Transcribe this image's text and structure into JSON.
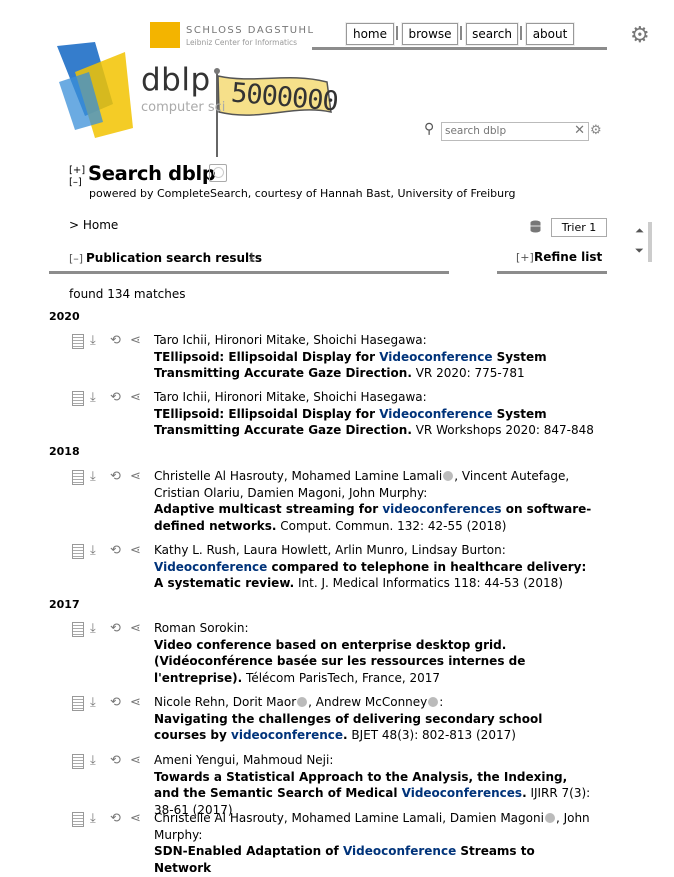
{
  "header": {
    "dagstuhl_title": "SCHLOSS DAGSTUHL",
    "dagstuhl_subtitle": "Leibniz Center for Informatics",
    "nav": [
      "home",
      "browse",
      "search",
      "about"
    ],
    "settings_icon": "gear-icon"
  },
  "logo": {
    "word": "dblp",
    "subtitle": "computer sci",
    "flag_text": "5000000"
  },
  "search": {
    "placeholder": "search dblp",
    "value": ""
  },
  "page": {
    "expand": "[+]",
    "collapse": "[–]",
    "title": "Search dblp",
    "powered_by": "powered by CompleteSearch, courtesy of Hannah Bast, University of Freiburg",
    "breadcrumb": "> Home",
    "mirror": "Trier 1"
  },
  "results": {
    "toggle": "[–]",
    "label": "Publication search results",
    "refine_toggle": "[+]",
    "refine_label": "Refine list",
    "found": "found 134 matches"
  },
  "years": [
    "2020",
    "2018",
    "2017"
  ],
  "entries": [
    {
      "authors": "Taro Ichii, Hironori Mitake, Shoichi Hasegawa:",
      "title_a": "TEllipsoid: Ellipsoidal Display for ",
      "title_hl": "Videoconference",
      "title_b": " System Transmitting Accurate Gaze Direction.",
      "venue": " VR 2020: 775-781"
    },
    {
      "authors": "Taro Ichii, Hironori Mitake, Shoichi Hasegawa:",
      "title_a": "TEllipsoid: Ellipsoidal Display for ",
      "title_hl": "Videoconference",
      "title_b": " System Transmitting Accurate Gaze Direction.",
      "venue": " VR Workshops 2020: 847-848"
    },
    {
      "authors_a": "Christelle Al Hasrouty, Mohamed Lamine Lamali",
      "authors_b": ", Vincent Autefage, Cristian Olariu, Damien Magoni, John Murphy:",
      "title_a": "Adaptive multicast streaming for ",
      "title_hl": "videoconferences",
      "title_b": " on software-defined networks.",
      "venue": " Comput. Commun. 132: 42-55 (2018)"
    },
    {
      "authors": "Kathy L. Rush, Laura Howlett, Arlin Munro, Lindsay Burton:",
      "title_a": "",
      "title_hl": "Videoconference",
      "title_b": " compared to telephone in healthcare delivery: A systematic review.",
      "venue": " Int. J. Medical Informatics 118: 44-53 (2018)"
    },
    {
      "authors": "Roman Sorokin:",
      "title_a": "Video conference based on enterprise desktop grid. (Vidéoconférence basée sur les ressources internes de l'entreprise).",
      "title_hl": "",
      "title_b": "",
      "venue": " Télécom ParisTech, France, 2017"
    },
    {
      "authors_a": "Nicole Rehn, Dorit Maor",
      "authors_b": ", Andrew McConney",
      "authors_c": ":",
      "title_a": "Navigating the challenges of delivering secondary school courses by ",
      "title_hl": "videoconference",
      "title_b": ".",
      "venue": " BJET 48(3): 802-813 (2017)"
    },
    {
      "authors": "Ameni Yengui, Mahmoud Neji:",
      "title_a": "Towards a Statistical Approach to the Analysis, the Indexing, and the Semantic Search of Medical ",
      "title_hl": "Videoconferences",
      "title_b": ".",
      "venue": " IJIRR 7(3): 38-61 (2017)"
    },
    {
      "authors_a": "Christelle Al Hasrouty, Mohamed Lamine Lamali, Damien Magoni",
      "authors_b": ", John Murphy:",
      "title_a": "SDN-Enabled Adaptation of ",
      "title_hl": "Videoconference",
      "title_b": " Streams to Network",
      "venue": ""
    }
  ],
  "icon_names": [
    "document-icon",
    "download-icon",
    "external-link-icon",
    "share-icon"
  ]
}
